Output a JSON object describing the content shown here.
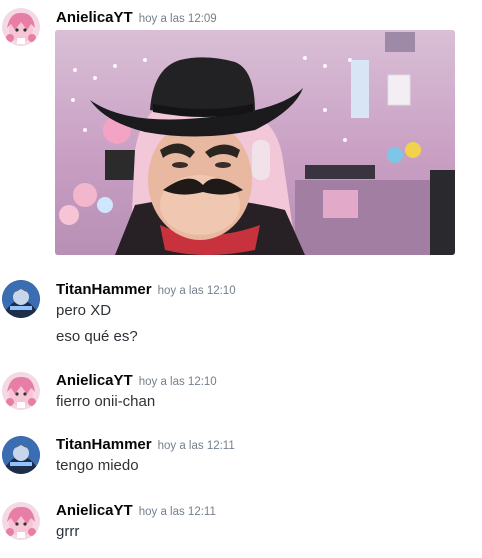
{
  "messages": [
    {
      "author": "AnielicaYT",
      "timestamp": "hoy a las 12:09",
      "avatar": "anime-pink-hair-avatar",
      "lines": [],
      "attachment": "image-cowboy-mask-photo"
    },
    {
      "author": "TitanHammer",
      "timestamp": "hoy a las 12:10",
      "avatar": "titan-blue-avatar",
      "lines": [
        "pero XD",
        "eso qué es?"
      ]
    },
    {
      "author": "AnielicaYT",
      "timestamp": "hoy a las 12:10",
      "avatar": "anime-pink-hair-avatar",
      "lines": [
        "fierro onii-chan"
      ]
    },
    {
      "author": "TitanHammer",
      "timestamp": "hoy a las 12:11",
      "avatar": "titan-blue-avatar",
      "lines": [
        "tengo miedo"
      ]
    },
    {
      "author": "AnielicaYT",
      "timestamp": "hoy a las 12:11",
      "avatar": "anime-pink-hair-avatar",
      "lines": [
        "grrr"
      ]
    }
  ],
  "colors": {
    "username": "#060607",
    "timestamp": "#747f8d",
    "message_text": "#2e3338",
    "background": "#ffffff"
  }
}
